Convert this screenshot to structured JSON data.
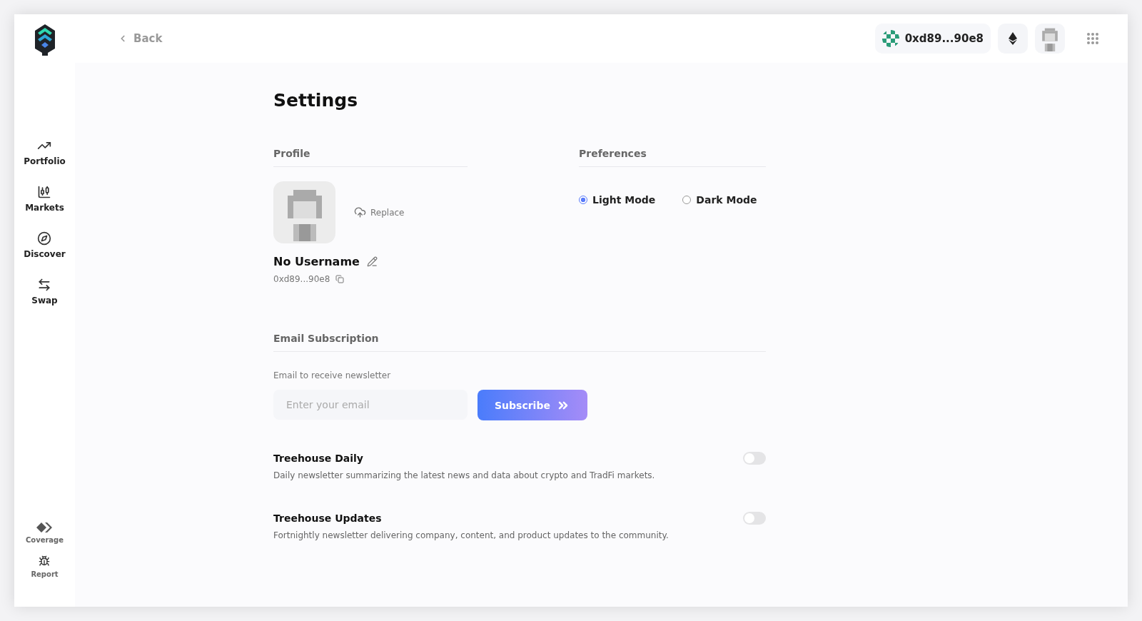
{
  "sidebar": {
    "items": [
      {
        "kind": "portfolio",
        "label": "Portfolio"
      },
      {
        "kind": "markets",
        "label": "Markets"
      },
      {
        "kind": "discover",
        "label": "Discover"
      },
      {
        "kind": "swap",
        "label": "Swap"
      }
    ],
    "footer_items": [
      {
        "kind": "coverage",
        "label": "Coverage"
      },
      {
        "kind": "report",
        "label": "Report"
      }
    ]
  },
  "topbar": {
    "back": "Back",
    "wallet": "0xd89...90e8"
  },
  "title": "Settings",
  "profile": {
    "heading": "Profile",
    "replace": "Replace",
    "username": "No Username",
    "address": "0xd89...90e8"
  },
  "preferences": {
    "heading": "Preferences",
    "options": [
      {
        "label": "Light Mode",
        "selected": true
      },
      {
        "label": "Dark Mode",
        "selected": false
      }
    ]
  },
  "email": {
    "heading": "Email Subscription",
    "label": "Email to receive newsletter",
    "placeholder": "Enter your email",
    "button": "Subscribe",
    "newsletters": [
      {
        "title": "Treehouse Daily",
        "description": "Daily newsletter summarizing the latest news and data about crypto and TradFi markets.",
        "on": false
      },
      {
        "title": "Treehouse Updates",
        "description": "Fortnightly newsletter delivering company, content, and product updates to the community.",
        "on": false
      }
    ]
  }
}
